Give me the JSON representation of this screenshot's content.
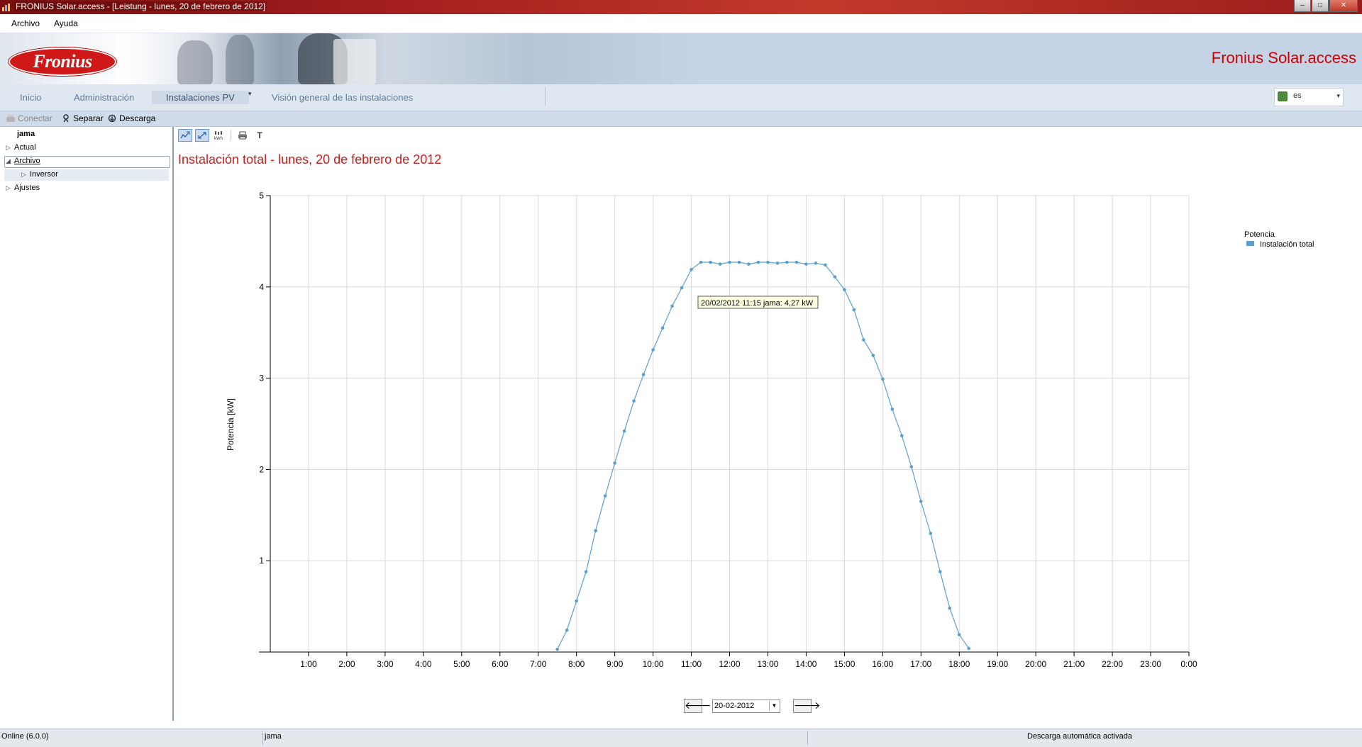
{
  "window": {
    "title": "FRONIUS Solar.access - [Leistung - lunes, 20 de febrero de 2012]",
    "buttons": {
      "minimize": "–",
      "maximize": "□",
      "close": "✕"
    }
  },
  "menu": {
    "items": [
      "Archivo",
      "Ayuda"
    ]
  },
  "banner": {
    "logo_text": "Fronius",
    "brand_title": "Fronius Solar.access"
  },
  "nav": {
    "tabs": [
      "Inicio",
      "Administración",
      "Instalaciones PV",
      "Visión general de las instalaciones"
    ],
    "active_tab": "Instalaciones PV",
    "dropdown_arrow": "▾",
    "language": "es",
    "language_dropdown": "▾"
  },
  "toolbar": {
    "connect": "Conectar",
    "disconnect": "Separar",
    "download": "Descarga"
  },
  "tree": {
    "root": "jama",
    "items": [
      "Actual",
      "Archivo",
      "Inversor",
      "Ajustes"
    ],
    "collapsed_arrow": "▷",
    "expanded_arrow": "◢"
  },
  "chart_toolbar": {
    "icons": [
      "zoom-icon",
      "fit-icon",
      "kwh-icon",
      "print-icon",
      "text-icon"
    ],
    "text_button": "T"
  },
  "report": {
    "title": "Instalación total - lunes, 20 de febrero de 2012"
  },
  "tooltip": {
    "text": "20/02/2012 11:15 jama: 4,27 kW"
  },
  "date_nav": {
    "prev": "🡐",
    "next": "🡒",
    "date": "20-02-2012"
  },
  "status": {
    "left": "Online (6.0.0)",
    "middle": "jama",
    "right": "Descarga automática activada"
  },
  "colors": {
    "accent_red": "#cc0000",
    "series_line": "#5b9fd0",
    "nav_text": "#5f7c9c"
  },
  "chart_data": {
    "type": "line",
    "ylabel": "Potencia [kW]",
    "xlabel": "",
    "ylim": [
      0,
      5
    ],
    "yticks": [
      "1",
      "2",
      "3",
      "4",
      "5"
    ],
    "xticks": [
      "1:00",
      "2:00",
      "3:00",
      "4:00",
      "5:00",
      "6:00",
      "7:00",
      "8:00",
      "9:00",
      "10:00",
      "11:00",
      "12:00",
      "13:00",
      "14:00",
      "15:00",
      "16:00",
      "17:00",
      "18:00",
      "19:00",
      "20:00",
      "21:00",
      "22:00",
      "23:00",
      "0:00"
    ],
    "legend": {
      "title": "Potencia",
      "position": "top-right"
    },
    "grid": true,
    "series": [
      {
        "name": "Instalación total",
        "color": "#5b9fd0",
        "x": [
          7.5,
          7.75,
          8.0,
          8.25,
          8.5,
          8.75,
          9.0,
          9.25,
          9.5,
          9.75,
          10.0,
          10.25,
          10.5,
          10.75,
          11.0,
          11.25,
          11.5,
          11.75,
          12.0,
          12.25,
          12.5,
          12.75,
          13.0,
          13.25,
          13.5,
          13.75,
          14.0,
          14.25,
          14.5,
          14.75,
          15.0,
          15.25,
          15.5,
          15.75,
          16.0,
          16.25,
          16.5,
          16.75,
          17.0,
          17.25,
          17.5,
          17.75,
          18.0,
          18.25
        ],
        "values": [
          0.03,
          0.24,
          0.56,
          0.88,
          1.33,
          1.71,
          2.07,
          2.42,
          2.75,
          3.04,
          3.31,
          3.55,
          3.79,
          3.99,
          4.19,
          4.27,
          4.27,
          4.25,
          4.27,
          4.27,
          4.25,
          4.27,
          4.27,
          4.26,
          4.27,
          4.27,
          4.25,
          4.26,
          4.24,
          4.11,
          3.97,
          3.75,
          3.42,
          3.25,
          2.99,
          2.66,
          2.37,
          2.03,
          1.65,
          1.3,
          0.88,
          0.48,
          0.19,
          0.04
        ]
      }
    ]
  }
}
